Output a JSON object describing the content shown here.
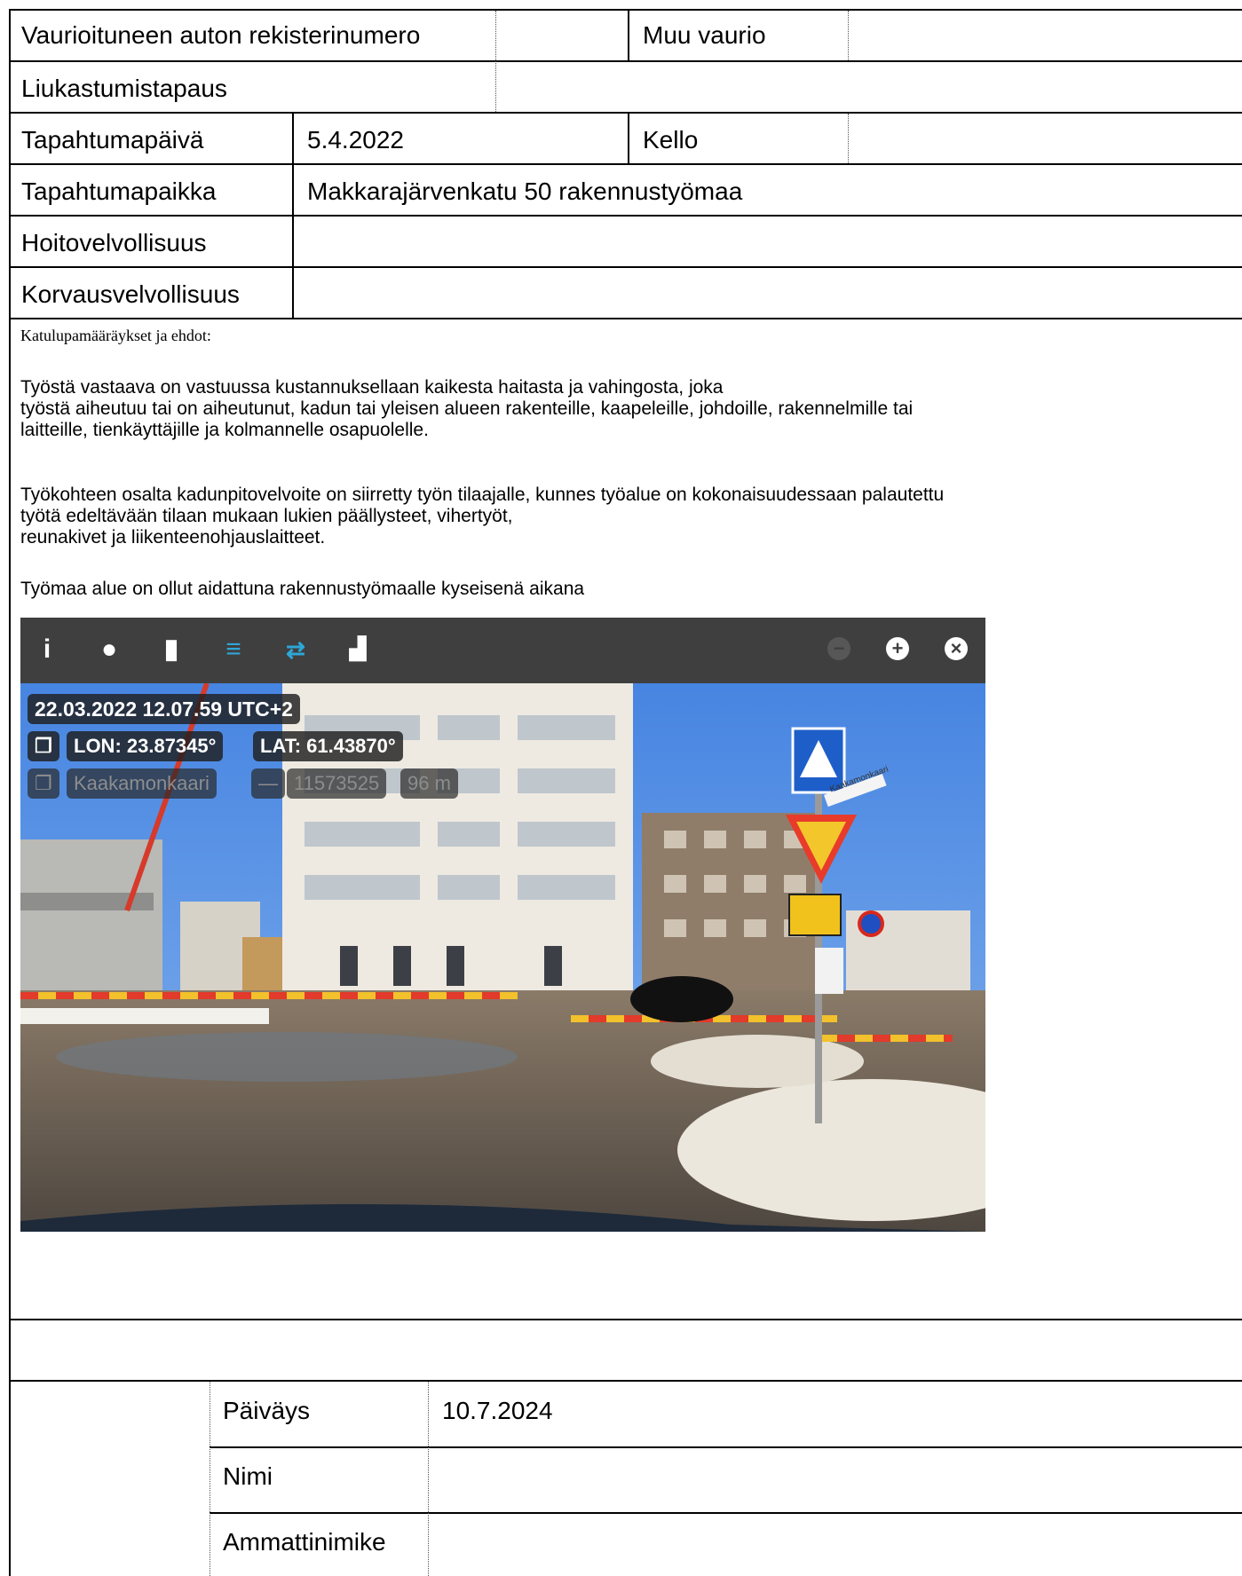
{
  "header_table": {
    "reg_label": "Vaurioituneen auton rekisterinumero",
    "reg_value": "",
    "other_damage_label": "Muu vaurio",
    "other_damage_value": "",
    "slip_label": "Liukastumistapaus",
    "slip_value": "",
    "date_label": "Tapahtumapäivä",
    "date_value": "5.4.2022",
    "time_label": "Kello",
    "time_value": "",
    "place_label": "Tapahtumapaikka",
    "place_value": "Makkarajärvenkatu 50 rakennustyömaa",
    "maintenance_label": "Hoitovelvollisuus",
    "maintenance_value": "",
    "compensation_label": "Korvausvelvollisuus",
    "compensation_value": ""
  },
  "terms": {
    "heading": "Katulupamääräykset ja ehdot:",
    "para1_line1": "Työstä vastaava on vastuussa kustannuksellaan kaikesta haitasta ja vahingosta, joka",
    "para1_line2": "työstä aiheutuu tai on aiheutunut, kadun tai yleisen alueen rakenteille, kaapeleille, johdoille, rakennelmille tai",
    "para1_line3": "laitteille, tienkäyttäjille ja kolmannelle osapuolelle.",
    "para2_line1": "Työkohteen osalta kadunpitovelvoite on siirretty työn tilaajalle, kunnes työalue on kokonaisuudessaan palautettu",
    "para2_line2": "työtä edeltävään tilaan mukaan lukien päällysteet, vihertyöt,",
    "para2_line3": "reunakivet ja liikenteenohjauslaitteet.",
    "para3": "Työmaa alue on ollut aidattuna rakennustyömaalle kyseisenä aikana"
  },
  "photo": {
    "timestamp": "22.03.2022 12.07.59 UTC+2",
    "lon": "LON: 23.87345°",
    "lat": "LAT: 61.43870°",
    "street": "Kaakamonkaari",
    "dash": "—",
    "code": "11573525",
    "distance": "96 m",
    "sign_text": "Kaakamonkaari",
    "toolbar_icons": [
      "info-icon",
      "pin-icon",
      "trash-icon",
      "list-icon",
      "repeat-icon",
      "chart-icon",
      "minus-icon",
      "plus-icon",
      "close-icon"
    ]
  },
  "signature": {
    "date_label": "Päiväys",
    "date_value": "10.7.2024",
    "name_label": "Nimi",
    "name_value": "",
    "title_label": "Ammattinimike",
    "title_value": ""
  }
}
